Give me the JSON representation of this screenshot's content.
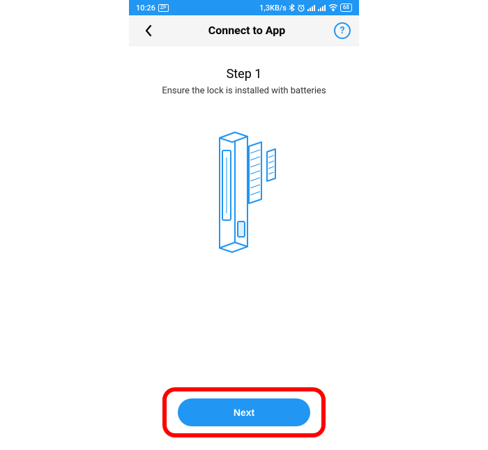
{
  "statusBar": {
    "time": "10:26",
    "zp": "ZP",
    "dataRate": "1,3KB/s",
    "battery": "68"
  },
  "nav": {
    "title": "Connect to App",
    "helpLabel": "?"
  },
  "step": {
    "title": "Step 1",
    "description": "Ensure the lock is installed with batteries"
  },
  "actions": {
    "nextLabel": "Next"
  }
}
